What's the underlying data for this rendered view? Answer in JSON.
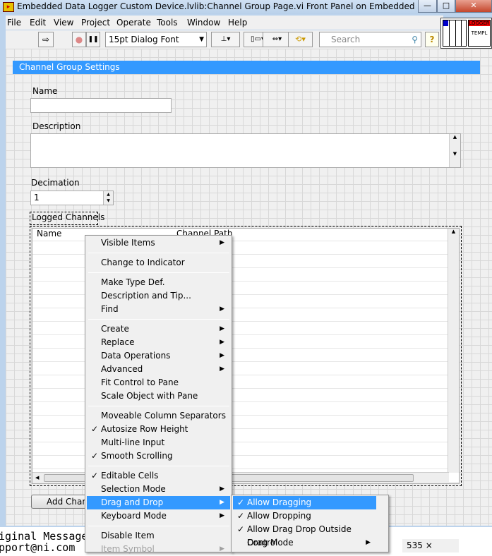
{
  "window": {
    "title": "Embedded Data Logger Custom Device.lvlib:Channel Group Page.vi Front Panel on Embedded Data Log...",
    "minimize": "—",
    "maximize": "□",
    "close": "✕"
  },
  "menubar": [
    "File",
    "Edit",
    "View",
    "Project",
    "Operate",
    "Tools",
    "Window",
    "Help"
  ],
  "toolbar": {
    "run": "⇨",
    "abort": "●",
    "pause": "❚❚",
    "font": "15pt Dialog Font",
    "align": "⊥▾",
    "distribute": "▯▭▾",
    "resize": "⇔▾",
    "reorder": "⟲▾",
    "search_placeholder": "Search",
    "help": "?"
  },
  "icon_pane": {
    "logger": "LOGGER",
    "templ": "TEMPL"
  },
  "panel": {
    "header": "Channel Group Settings",
    "name_label": "Name",
    "name_value": "",
    "description_label": "Description",
    "description_value": "",
    "decimation_label": "Decimation",
    "decimation_value": "1",
    "logged_channels_label": "Logged Channels",
    "table_headers": [
      "Name",
      "Channel Path"
    ],
    "add_button": "Add Chan"
  },
  "context_menu": [
    {
      "label": "Visible Items",
      "submenu": true
    },
    {
      "label": "Change to Indicator"
    },
    {
      "label": "Make Type Def."
    },
    {
      "label": "Description and Tip..."
    },
    {
      "label": "Find",
      "submenu": true
    },
    {
      "label": "Create",
      "submenu": true
    },
    {
      "label": "Replace",
      "submenu": true
    },
    {
      "label": "Data Operations",
      "submenu": true
    },
    {
      "label": "Advanced",
      "submenu": true
    },
    {
      "label": "Fit Control to Pane"
    },
    {
      "label": "Scale Object with Pane"
    },
    {
      "label": "Moveable Column Separators"
    },
    {
      "label": "Autosize Row Height",
      "checked": true
    },
    {
      "label": "Multi-line Input"
    },
    {
      "label": "Smooth Scrolling",
      "checked": true
    },
    {
      "label": "Editable Cells",
      "checked": true
    },
    {
      "label": "Selection Mode",
      "submenu": true
    },
    {
      "label": "Drag and Drop",
      "submenu": true,
      "highlighted": true
    },
    {
      "label": "Keyboard Mode",
      "submenu": true
    },
    {
      "label": "Disable Item"
    },
    {
      "label": "Item Symbol",
      "submenu": true,
      "disabled": true
    }
  ],
  "submenu": [
    {
      "label": "Allow Dragging",
      "checked": true,
      "highlighted": true
    },
    {
      "label": "Allow Dropping",
      "checked": true
    },
    {
      "label": "Allow Drag Drop Outside Control",
      "checked": true
    },
    {
      "label": "Drag Mode",
      "submenu": true
    }
  ],
  "background": {
    "line1": "iginal Message",
    "line2": "pport@ni.com",
    "size_readout": "535 ×"
  },
  "colors": {
    "accent": "#3399ff"
  }
}
